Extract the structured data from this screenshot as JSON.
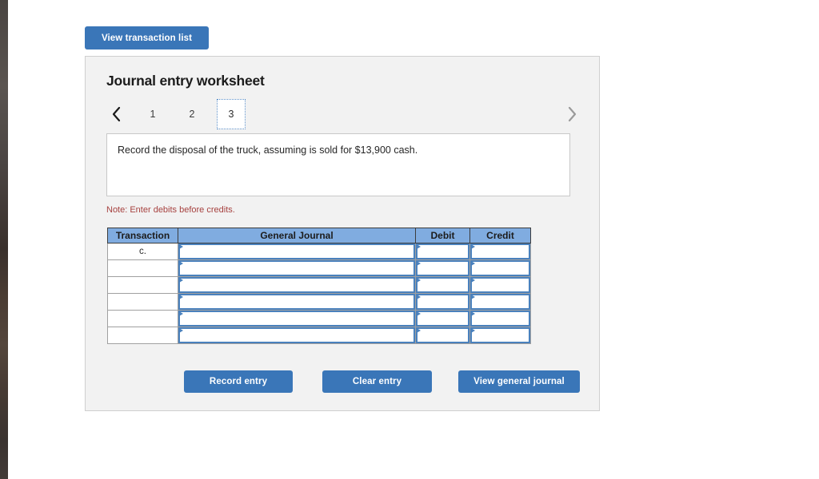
{
  "toolbar": {
    "view_transaction_list_label": "View transaction list"
  },
  "top_cut_text": "",
  "card": {
    "title": "Journal entry worksheet",
    "pager": {
      "prev_icon": "chevron-left-icon",
      "next_icon": "chevron-right-icon",
      "tabs": [
        {
          "label": "1",
          "active": false
        },
        {
          "label": "2",
          "active": false
        },
        {
          "label": "3",
          "active": true
        }
      ]
    },
    "instruction": "Record the disposal of the truck, assuming is sold for $13,900 cash.",
    "note": "Note: Enter debits before credits.",
    "table": {
      "columns": [
        "Transaction",
        "General Journal",
        "Debit",
        "Credit"
      ],
      "rows": [
        {
          "transaction": "c.",
          "journal": "",
          "debit": "",
          "credit": ""
        },
        {
          "transaction": "",
          "journal": "",
          "debit": "",
          "credit": ""
        },
        {
          "transaction": "",
          "journal": "",
          "debit": "",
          "credit": ""
        },
        {
          "transaction": "",
          "journal": "",
          "debit": "",
          "credit": ""
        },
        {
          "transaction": "",
          "journal": "",
          "debit": "",
          "credit": ""
        },
        {
          "transaction": "",
          "journal": "",
          "debit": "",
          "credit": ""
        }
      ]
    },
    "actions": {
      "record_entry_label": "Record entry",
      "clear_entry_label": "Clear entry",
      "view_general_journal_label": "View general journal"
    }
  },
  "colors": {
    "button_blue": "#3a76b8",
    "table_header_blue": "#80ace0",
    "input_border_blue": "#4a81bd",
    "note_red": "#a6413f",
    "card_bg": "#f2f2f2"
  }
}
